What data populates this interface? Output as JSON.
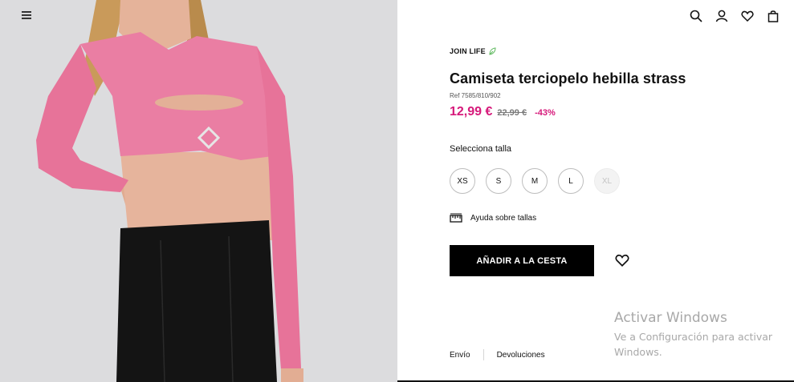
{
  "product": {
    "brand_tag": "JOIN LIFE",
    "title": "Camiseta terciopelo hebilla strass",
    "ref": "Ref 7585/810/902",
    "price_now": "12,99 €",
    "price_old": "22,99 €",
    "discount": "-43%"
  },
  "sizes": {
    "label": "Selecciona talla",
    "options": [
      {
        "label": "XS",
        "available": true
      },
      {
        "label": "S",
        "available": true
      },
      {
        "label": "M",
        "available": true
      },
      {
        "label": "L",
        "available": true
      },
      {
        "label": "XL",
        "available": false
      }
    ]
  },
  "help": {
    "label": "Ayuda sobre tallas"
  },
  "cart": {
    "add_label": "AÑADIR A LA CESTA"
  },
  "footer": {
    "shipping": "Envío",
    "returns": "Devoluciones"
  },
  "header": {
    "icons": [
      "search-icon",
      "user-icon",
      "heart-icon",
      "bag-icon"
    ],
    "menu_icon": "hamburger-menu-icon"
  },
  "watermark": {
    "title": "Activar Windows",
    "line1": "Ve a Configuración para activar",
    "line2": "Windows."
  },
  "colors": {
    "accent_price": "#d6197a",
    "button_bg": "#000000",
    "image_bg": "#dcdcde",
    "garment": "#ea7ea3"
  }
}
